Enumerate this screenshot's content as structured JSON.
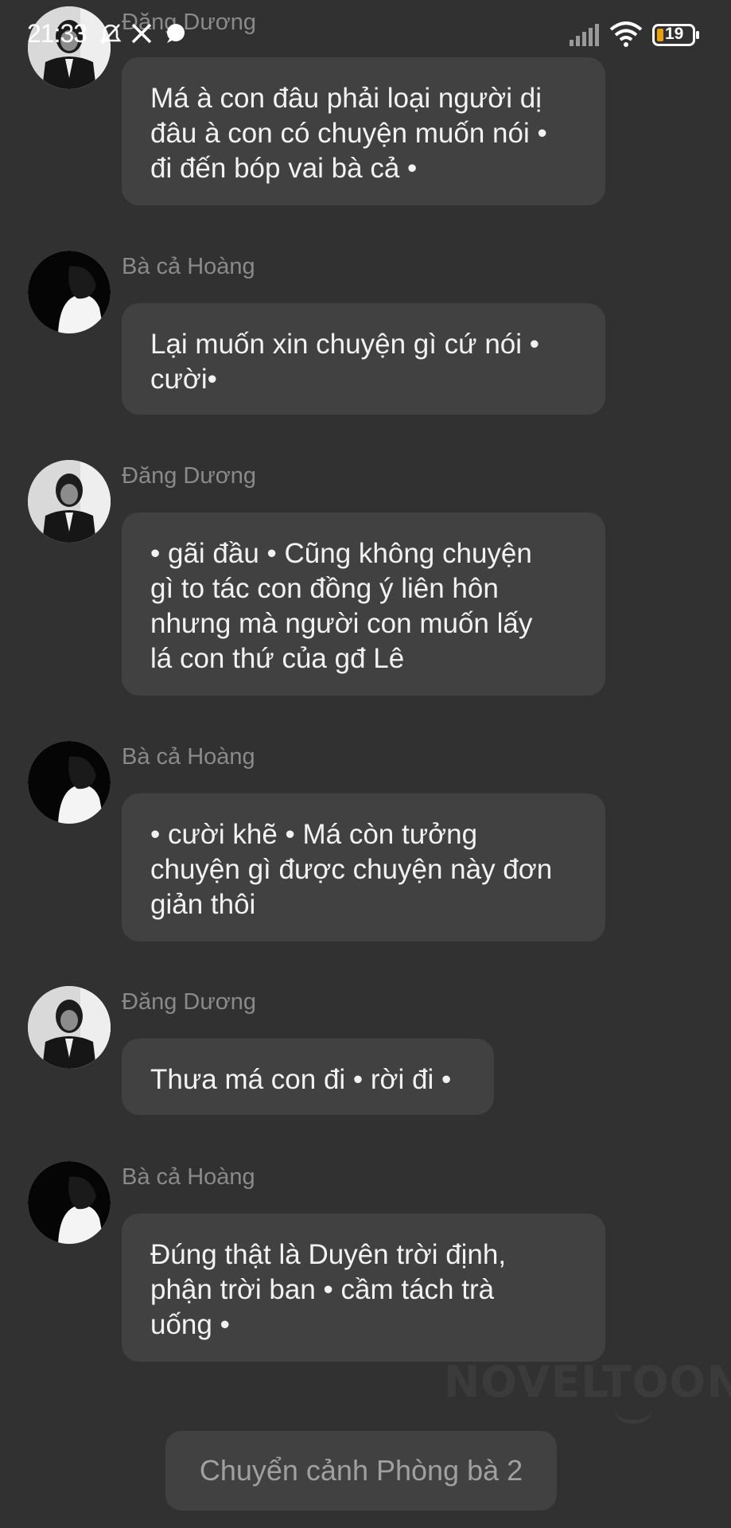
{
  "status_bar": {
    "time": "21:33",
    "battery": "19",
    "icons": [
      "mute-bell-icon",
      "x-logo-icon",
      "chat-bubble-icon",
      "signal-icon",
      "wifi-icon",
      "battery-icon"
    ]
  },
  "messages": [
    {
      "sender": "Đăng Dương",
      "avatar": "avatar-dang-duong",
      "lines": [
        "Má à con đâu phải loại người dị",
        "đâu à con có chuyện muốn nói •",
        "đi đến bóp vai bà cả •"
      ]
    },
    {
      "sender": "Bà cả Hoàng",
      "avatar": "avatar-ba-ca-hoang",
      "lines": [
        "Lại muốn xin chuyện gì cứ nói •",
        "cười•"
      ]
    },
    {
      "sender": "Đăng Dương",
      "avatar": "avatar-dang-duong",
      "lines": [
        "• gãi đầu • Cũng không chuyện",
        "gì to tác con đồng ý liên hôn",
        "nhưng mà người con muốn lấy",
        "lá con thứ của gđ Lê"
      ]
    },
    {
      "sender": "Bà cả Hoàng",
      "avatar": "avatar-ba-ca-hoang",
      "lines": [
        "• cười khẽ • Má còn tưởng",
        "chuyện gì được chuyện này đơn",
        "giản thôi"
      ]
    },
    {
      "sender": "Đăng Dương",
      "avatar": "avatar-dang-duong",
      "lines": [
        "Thưa má con đi • rời đi •"
      ]
    },
    {
      "sender": "Bà cả Hoàng",
      "avatar": "avatar-ba-ca-hoang",
      "lines": [
        "Đúng thật là Duyên trời định,",
        "phận trời ban • cầm tách trà",
        "uống •"
      ]
    }
  ],
  "watermark": "NOVELTOON",
  "scene_button": "Chuyển cảnh Phòng bà 2",
  "colors": {
    "background": "#313131",
    "bubble": "#414141",
    "sender": "#8a8a8a",
    "text": "#f2f2f2"
  }
}
